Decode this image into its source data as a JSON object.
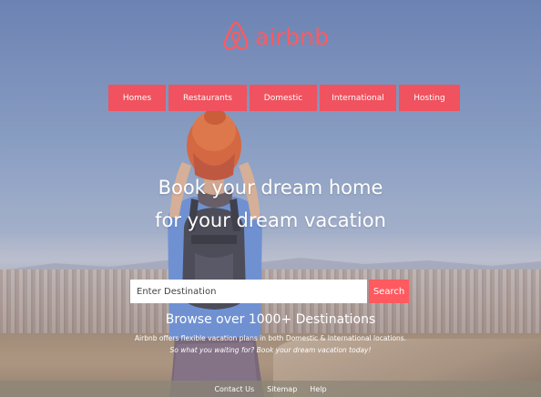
{
  "brand": {
    "name": "airbnb",
    "color": "#ff5a5f",
    "icon": "airbnb-belo-icon"
  },
  "nav": {
    "items": [
      {
        "label": "Homes"
      },
      {
        "label": "Restaurants"
      },
      {
        "label": "Domestic"
      },
      {
        "label": "International"
      },
      {
        "label": "Hosting"
      }
    ],
    "color": "#f0525f"
  },
  "hero": {
    "headline_line1": "Book your dream home",
    "headline_line2": "for your dream vacation"
  },
  "search": {
    "placeholder": "Enter Destination",
    "value": "",
    "button_label": "Search"
  },
  "browse": {
    "title": "Browse over 1000+ Destinations",
    "description": "Airbnb offers flexible vacation plans in both Domestic & International locations.",
    "cta": "So what you waiting for? Book your dream vacation today!"
  },
  "footer": {
    "links": [
      {
        "label": "Contact Us"
      },
      {
        "label": "Sitemap"
      },
      {
        "label": "Help"
      }
    ]
  }
}
